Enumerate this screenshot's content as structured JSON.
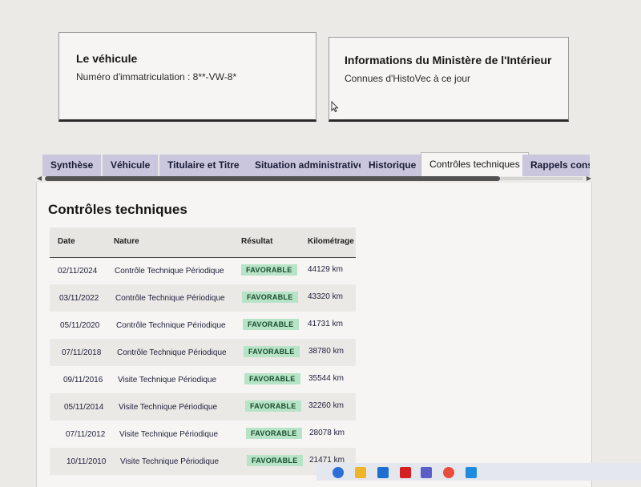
{
  "vehicle_card": {
    "title": "Le véhicule",
    "registration_label": "Numéro d'immatriculation : 8**-VW-8*"
  },
  "ministry_card": {
    "title": "Informations du Ministère de l'Intérieur",
    "subtitle": "Connues d'HistoVec à ce jour"
  },
  "tabs": [
    {
      "label": "Synthèse",
      "active": false
    },
    {
      "label": "Véhicule",
      "active": false
    },
    {
      "label": "Titulaire et Titre",
      "active": false
    },
    {
      "label": "Situation administrative",
      "active": false
    },
    {
      "label": "Historique",
      "active": false
    },
    {
      "label": "Contrôles techniques",
      "active": true
    },
    {
      "label": "Rappels constructeur",
      "active": false
    }
  ],
  "section": {
    "title": "Contrôles techniques",
    "columns": [
      "Date",
      "Nature",
      "Résultat",
      "Kilométrage"
    ],
    "rows": [
      {
        "date": "02/11/2024",
        "nature": "Contrôle Technique Périodique",
        "result": "FAVORABLE",
        "km": "44129 km"
      },
      {
        "date": "03/11/2022",
        "nature": "Contrôle Technique Périodique",
        "result": "FAVORABLE",
        "km": "43320 km"
      },
      {
        "date": "05/11/2020",
        "nature": "Contrôle Technique Périodique",
        "result": "FAVORABLE",
        "km": "41731 km"
      },
      {
        "date": "07/11/2018",
        "nature": "Contrôle Technique Périodique",
        "result": "FAVORABLE",
        "km": "38780 km"
      },
      {
        "date": "09/11/2016",
        "nature": "Visite Technique Périodique",
        "result": "FAVORABLE",
        "km": "35544 km"
      },
      {
        "date": "05/11/2014",
        "nature": "Visite Technique Périodique",
        "result": "FAVORABLE",
        "km": "32260 km"
      },
      {
        "date": "07/11/2012",
        "nature": "Visite Technique Périodique",
        "result": "FAVORABLE",
        "km": "28078 km"
      },
      {
        "date": "10/11/2010",
        "nature": "Visite Technique Périodique",
        "result": "FAVORABLE",
        "km": "21471 km"
      }
    ]
  },
  "colors": {
    "tab_bg": "#c9c6dd",
    "badge_bg": "#b7e3c7",
    "badge_text": "#184d2c"
  },
  "taskbar_icons": [
    "search-icon",
    "edge-icon",
    "file-explorer-icon",
    "store-icon",
    "app-l-icon",
    "teams-icon",
    "chrome-icon",
    "app-blue-icon"
  ]
}
